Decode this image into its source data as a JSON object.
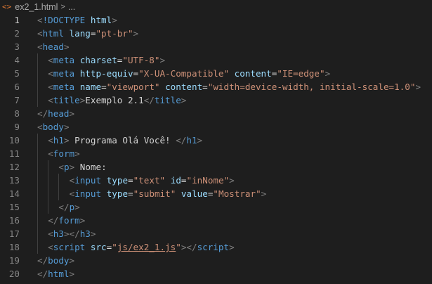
{
  "breadcrumb": {
    "file_icon": "html-file-icon",
    "file_icon_glyph": "<>",
    "file_name": "ex2_1.html",
    "separator": ">",
    "more": "..."
  },
  "editor": {
    "active_line": 1,
    "lines": [
      {
        "n": "1",
        "indent": 0,
        "tokens": [
          {
            "t": "b",
            "v": "<"
          },
          {
            "t": "tag",
            "v": "!DOCTYPE"
          },
          {
            "t": "txt",
            "v": " "
          },
          {
            "t": "attr",
            "v": "html"
          },
          {
            "t": "b",
            "v": ">"
          }
        ]
      },
      {
        "n": "2",
        "indent": 0,
        "tokens": [
          {
            "t": "b",
            "v": "<"
          },
          {
            "t": "tag",
            "v": "html"
          },
          {
            "t": "txt",
            "v": " "
          },
          {
            "t": "attr",
            "v": "lang"
          },
          {
            "t": "txt",
            "v": "="
          },
          {
            "t": "str",
            "v": "\"pt-br\""
          },
          {
            "t": "b",
            "v": ">"
          }
        ]
      },
      {
        "n": "3",
        "indent": 0,
        "tokens": [
          {
            "t": "b",
            "v": "<"
          },
          {
            "t": "tag",
            "v": "head"
          },
          {
            "t": "b",
            "v": ">"
          }
        ]
      },
      {
        "n": "4",
        "indent": 1,
        "tokens": [
          {
            "t": "b",
            "v": "<"
          },
          {
            "t": "tag",
            "v": "meta"
          },
          {
            "t": "txt",
            "v": " "
          },
          {
            "t": "attr",
            "v": "charset"
          },
          {
            "t": "txt",
            "v": "="
          },
          {
            "t": "str",
            "v": "\"UTF-8\""
          },
          {
            "t": "b",
            "v": ">"
          }
        ]
      },
      {
        "n": "5",
        "indent": 1,
        "tokens": [
          {
            "t": "b",
            "v": "<"
          },
          {
            "t": "tag",
            "v": "meta"
          },
          {
            "t": "txt",
            "v": " "
          },
          {
            "t": "attr",
            "v": "http-equiv"
          },
          {
            "t": "txt",
            "v": "="
          },
          {
            "t": "str",
            "v": "\"X-UA-Compatible\""
          },
          {
            "t": "txt",
            "v": " "
          },
          {
            "t": "attr",
            "v": "content"
          },
          {
            "t": "txt",
            "v": "="
          },
          {
            "t": "str",
            "v": "\"IE=edge\""
          },
          {
            "t": "b",
            "v": ">"
          }
        ]
      },
      {
        "n": "6",
        "indent": 1,
        "tokens": [
          {
            "t": "b",
            "v": "<"
          },
          {
            "t": "tag",
            "v": "meta"
          },
          {
            "t": "txt",
            "v": " "
          },
          {
            "t": "attr",
            "v": "name"
          },
          {
            "t": "txt",
            "v": "="
          },
          {
            "t": "str",
            "v": "\"viewport\""
          },
          {
            "t": "txt",
            "v": " "
          },
          {
            "t": "attr",
            "v": "content"
          },
          {
            "t": "txt",
            "v": "="
          },
          {
            "t": "str",
            "v": "\"width=device-width, initial-scale=1.0\""
          },
          {
            "t": "b",
            "v": ">"
          }
        ]
      },
      {
        "n": "7",
        "indent": 1,
        "tokens": [
          {
            "t": "b",
            "v": "<"
          },
          {
            "t": "tag",
            "v": "title"
          },
          {
            "t": "b",
            "v": ">"
          },
          {
            "t": "txt",
            "v": "Exemplo 2.1"
          },
          {
            "t": "b",
            "v": "</"
          },
          {
            "t": "tag",
            "v": "title"
          },
          {
            "t": "b",
            "v": ">"
          }
        ]
      },
      {
        "n": "8",
        "indent": 0,
        "tokens": [
          {
            "t": "b",
            "v": "</"
          },
          {
            "t": "tag",
            "v": "head"
          },
          {
            "t": "b",
            "v": ">"
          }
        ]
      },
      {
        "n": "9",
        "indent": 0,
        "tokens": [
          {
            "t": "b",
            "v": "<"
          },
          {
            "t": "tag",
            "v": "body"
          },
          {
            "t": "b",
            "v": ">"
          }
        ]
      },
      {
        "n": "10",
        "indent": 1,
        "tokens": [
          {
            "t": "b",
            "v": "<"
          },
          {
            "t": "tag",
            "v": "h1"
          },
          {
            "t": "b",
            "v": ">"
          },
          {
            "t": "txt",
            "v": " Programa Olá Você! "
          },
          {
            "t": "b",
            "v": "</"
          },
          {
            "t": "tag",
            "v": "h1"
          },
          {
            "t": "b",
            "v": ">"
          }
        ]
      },
      {
        "n": "11",
        "indent": 1,
        "tokens": [
          {
            "t": "b",
            "v": "<"
          },
          {
            "t": "tag",
            "v": "form"
          },
          {
            "t": "b",
            "v": ">"
          }
        ]
      },
      {
        "n": "12",
        "indent": 2,
        "tokens": [
          {
            "t": "b",
            "v": "<"
          },
          {
            "t": "tag",
            "v": "p"
          },
          {
            "t": "b",
            "v": ">"
          },
          {
            "t": "txt",
            "v": " Nome:"
          }
        ]
      },
      {
        "n": "13",
        "indent": 3,
        "tokens": [
          {
            "t": "b",
            "v": "<"
          },
          {
            "t": "tag",
            "v": "input"
          },
          {
            "t": "txt",
            "v": " "
          },
          {
            "t": "attr",
            "v": "type"
          },
          {
            "t": "txt",
            "v": "="
          },
          {
            "t": "str",
            "v": "\"text\""
          },
          {
            "t": "txt",
            "v": " "
          },
          {
            "t": "attr",
            "v": "id"
          },
          {
            "t": "txt",
            "v": "="
          },
          {
            "t": "str",
            "v": "\"inNome\""
          },
          {
            "t": "b",
            "v": ">"
          }
        ]
      },
      {
        "n": "14",
        "indent": 3,
        "tokens": [
          {
            "t": "b",
            "v": "<"
          },
          {
            "t": "tag",
            "v": "input"
          },
          {
            "t": "txt",
            "v": " "
          },
          {
            "t": "attr",
            "v": "type"
          },
          {
            "t": "txt",
            "v": "="
          },
          {
            "t": "str",
            "v": "\"submit\""
          },
          {
            "t": "txt",
            "v": " "
          },
          {
            "t": "attr",
            "v": "value"
          },
          {
            "t": "txt",
            "v": "="
          },
          {
            "t": "str",
            "v": "\"Mostrar\""
          },
          {
            "t": "b",
            "v": ">"
          }
        ]
      },
      {
        "n": "15",
        "indent": 2,
        "tokens": [
          {
            "t": "b",
            "v": "</"
          },
          {
            "t": "tag",
            "v": "p"
          },
          {
            "t": "b",
            "v": ">"
          }
        ]
      },
      {
        "n": "16",
        "indent": 1,
        "tokens": [
          {
            "t": "b",
            "v": "</"
          },
          {
            "t": "tag",
            "v": "form"
          },
          {
            "t": "b",
            "v": ">"
          }
        ]
      },
      {
        "n": "17",
        "indent": 1,
        "tokens": [
          {
            "t": "b",
            "v": "<"
          },
          {
            "t": "tag",
            "v": "h3"
          },
          {
            "t": "b",
            "v": "></"
          },
          {
            "t": "tag",
            "v": "h3"
          },
          {
            "t": "b",
            "v": ">"
          }
        ]
      },
      {
        "n": "18",
        "indent": 1,
        "tokens": [
          {
            "t": "b",
            "v": "<"
          },
          {
            "t": "tag",
            "v": "script"
          },
          {
            "t": "txt",
            "v": " "
          },
          {
            "t": "attr",
            "v": "src"
          },
          {
            "t": "txt",
            "v": "="
          },
          {
            "t": "str",
            "v": "\""
          },
          {
            "t": "strlink",
            "v": "js/ex2_1.js"
          },
          {
            "t": "str",
            "v": "\""
          },
          {
            "t": "b",
            "v": "></"
          },
          {
            "t": "tag",
            "v": "script"
          },
          {
            "t": "b",
            "v": ">"
          }
        ]
      },
      {
        "n": "19",
        "indent": 0,
        "tokens": [
          {
            "t": "b",
            "v": "</"
          },
          {
            "t": "tag",
            "v": "body"
          },
          {
            "t": "b",
            "v": ">"
          }
        ]
      },
      {
        "n": "20",
        "indent": 0,
        "tokens": [
          {
            "t": "b",
            "v": "</"
          },
          {
            "t": "tag",
            "v": "html"
          },
          {
            "t": "b",
            "v": ">"
          }
        ]
      }
    ]
  }
}
